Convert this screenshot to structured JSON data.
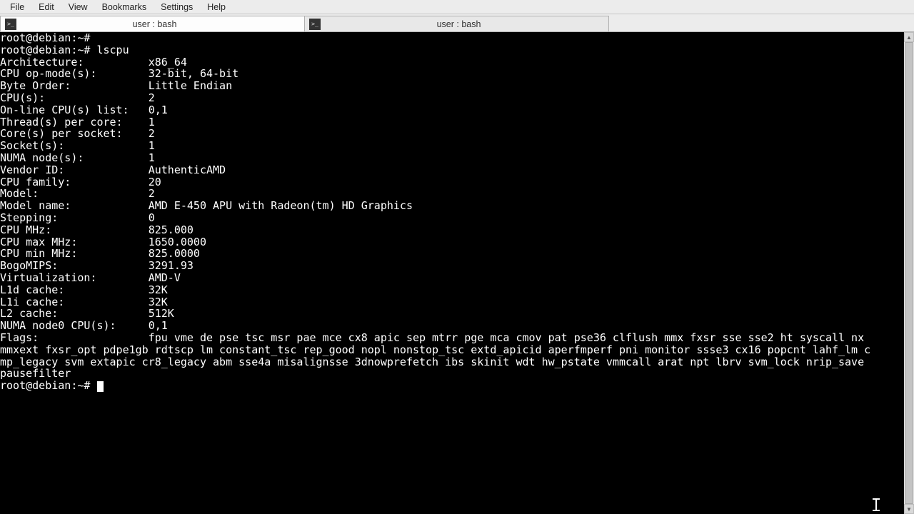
{
  "menubar": {
    "items": [
      "File",
      "Edit",
      "View",
      "Bookmarks",
      "Settings",
      "Help"
    ]
  },
  "tabs": [
    {
      "title": "user : bash",
      "active": true
    },
    {
      "title": "user : bash",
      "active": false
    }
  ],
  "terminal": {
    "prompt": "root@debian:~#",
    "command": "lscpu",
    "rows": [
      {
        "k": "Architecture:",
        "v": "x86_64"
      },
      {
        "k": "CPU op-mode(s):",
        "v": "32-bit, 64-bit"
      },
      {
        "k": "Byte Order:",
        "v": "Little Endian"
      },
      {
        "k": "CPU(s):",
        "v": "2"
      },
      {
        "k": "On-line CPU(s) list:",
        "v": "0,1"
      },
      {
        "k": "Thread(s) per core:",
        "v": "1"
      },
      {
        "k": "Core(s) per socket:",
        "v": "2"
      },
      {
        "k": "Socket(s):",
        "v": "1"
      },
      {
        "k": "NUMA node(s):",
        "v": "1"
      },
      {
        "k": "Vendor ID:",
        "v": "AuthenticAMD"
      },
      {
        "k": "CPU family:",
        "v": "20"
      },
      {
        "k": "Model:",
        "v": "2"
      },
      {
        "k": "Model name:",
        "v": "AMD E-450 APU with Radeon(tm) HD Graphics"
      },
      {
        "k": "Stepping:",
        "v": "0"
      },
      {
        "k": "CPU MHz:",
        "v": "825.000"
      },
      {
        "k": "CPU max MHz:",
        "v": "1650.0000"
      },
      {
        "k": "CPU min MHz:",
        "v": "825.0000"
      },
      {
        "k": "BogoMIPS:",
        "v": "3291.93"
      },
      {
        "k": "Virtualization:",
        "v": "AMD-V"
      },
      {
        "k": "L1d cache:",
        "v": "32K"
      },
      {
        "k": "L1i cache:",
        "v": "32K"
      },
      {
        "k": "L2 cache:",
        "v": "512K"
      },
      {
        "k": "NUMA node0 CPU(s):",
        "v": "0,1"
      }
    ],
    "flags_label": "Flags:",
    "flags_wrapped": [
      "fpu vme de pse tsc msr pae mce cx8 apic sep mtrr pge mca cmov pat pse36 clflush mmx fxsr sse sse2 ht syscall nx",
      "mmxext fxsr_opt pdpe1gb rdtscp lm constant_tsc rep_good nopl nonstop_tsc extd_apicid aperfmperf pni monitor ssse3 cx16 popcnt lahf_lm c",
      "mp_legacy svm extapic cr8_legacy abm sse4a misalignsse 3dnowprefetch ibs skinit wdt hw_pstate vmmcall arat npt lbrv svm_lock nrip_save",
      "pausefilter"
    ]
  },
  "layout": {
    "label_col_width": 23
  }
}
